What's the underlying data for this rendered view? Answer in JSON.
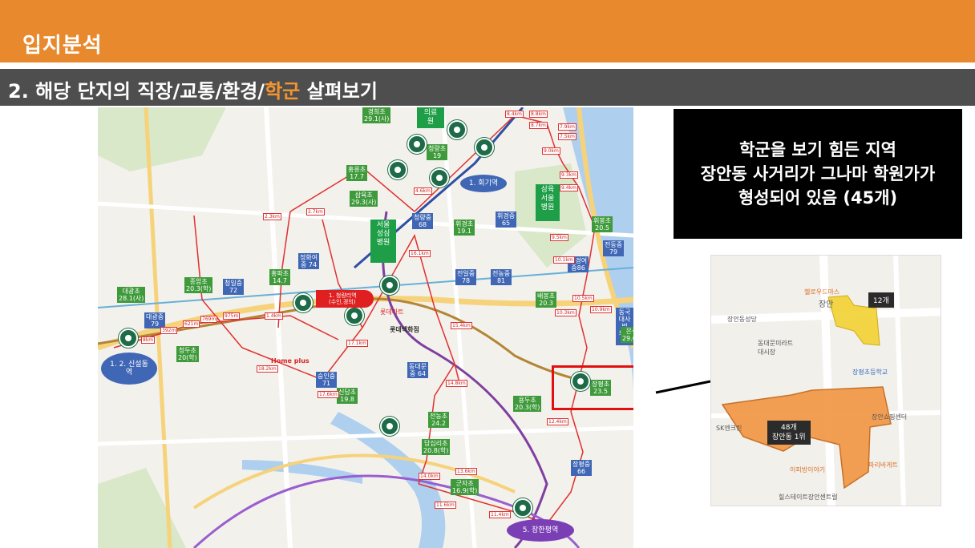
{
  "header": {
    "title": "입지분석",
    "subtitle_prefix": "2. 해당 단지의 직장/교통/환경/",
    "subtitle_highlight": "학군",
    "subtitle_suffix": " 살펴보기"
  },
  "callout": {
    "line1": "학군을 보기 힘든 지역",
    "line2": "장안동 사거리가 그나마 학원가가",
    "line3": "형성되어 있음 (45개)"
  },
  "map": {
    "hospitals": [
      {
        "label": "의료\n원"
      },
      {
        "label": "서울\n성심\n병원"
      },
      {
        "label": "삼육\n서울\n병원"
      }
    ],
    "schools": [
      {
        "label": "경희초\n29.1(사)",
        "color": "green"
      },
      {
        "label": "청량초\n19",
        "color": "green"
      },
      {
        "label": "홍릉초\n17.7",
        "color": "green"
      },
      {
        "label": "삼육초\n29.3(사)",
        "color": "green"
      },
      {
        "label": "청량중\n68",
        "color": "blue"
      },
      {
        "label": "휘경초\n19.1",
        "color": "green"
      },
      {
        "label": "휘경중\n65",
        "color": "blue"
      },
      {
        "label": "휘봉초\n20.5",
        "color": "green"
      },
      {
        "label": "전동중\n79",
        "color": "blue"
      },
      {
        "label": "정화여\n중 74",
        "color": "blue"
      },
      {
        "label": "홍파초\n14.7",
        "color": "green"
      },
      {
        "label": "전일중\n78",
        "color": "blue"
      },
      {
        "label": "전농중\n81",
        "color": "blue"
      },
      {
        "label": "휘경여\n중86",
        "color": "blue"
      },
      {
        "label": "종암초\n20.3(학)",
        "color": "green"
      },
      {
        "label": "청일중\n72",
        "color": "blue"
      },
      {
        "label": "대광초\n28.1(사)",
        "color": "green"
      },
      {
        "label": "배봉초\n20.3",
        "color": "green"
      },
      {
        "label": "대광중\n79",
        "color": "blue"
      },
      {
        "label": "동국대사범\n부속 68",
        "color": "blue"
      },
      {
        "label": "은석초\n29.6(사)",
        "color": "green"
      },
      {
        "label": "청두초\n20(학)",
        "color": "green"
      },
      {
        "label": "동대문\n중 64",
        "color": "blue"
      },
      {
        "label": "숭인중\n71",
        "color": "blue"
      },
      {
        "label": "신답초\n19.8",
        "color": "green"
      },
      {
        "label": "장평초\n23.5",
        "color": "green"
      },
      {
        "label": "용두초\n20.3(학)",
        "color": "green"
      },
      {
        "label": "전농초\n24.2",
        "color": "green"
      },
      {
        "label": "답십리초\n20.8(학)",
        "color": "green"
      },
      {
        "label": "장평중\n66",
        "color": "blue"
      },
      {
        "label": "군자초\n16.9(학)",
        "color": "green"
      }
    ],
    "distances": [
      "8.4km",
      "8.8km",
      "8.7km",
      "7.9km",
      "7.5km",
      "9.0km",
      "9.3km",
      "9.4km",
      "4.6km",
      "2.3km",
      "2.7km",
      "16.1km",
      "9.5km",
      "10.1km",
      "10.3km",
      "10.5km",
      "10.9km",
      "1.4km",
      "769m",
      "975m",
      "392m",
      "621m",
      "8km",
      "17.1km",
      "18.2km",
      "17.6km",
      "15.4km",
      "14.8km",
      "12.4km",
      "11.6km",
      "14.0km",
      "13.6km",
      "11.4km"
    ],
    "stations": [
      {
        "label": "1. 회기역"
      },
      {
        "label": "1. 2. 신설동\n역"
      },
      {
        "label": "5. 장한평역"
      }
    ],
    "poi": {
      "lotte_mart": "롯데마트",
      "lotte_dept": "롯데백화점",
      "homeplus": "Home plus",
      "cheongnyangni": "1. 청량리역\n(수인,경의)"
    }
  },
  "inset": {
    "tag_top": "12개",
    "tag_bottom_count": "48개",
    "tag_bottom_name": "장안동 1위",
    "place_labels": [
      "헬로우드마스",
      "장안",
      "장안동성당",
      "동대문미라트\n대시장",
      "장평초등학교",
      "장안쇼핑센터",
      "SK엔크린",
      "이피방이야기",
      "파리바게트",
      "힐스테이트장안센트럴"
    ]
  }
}
